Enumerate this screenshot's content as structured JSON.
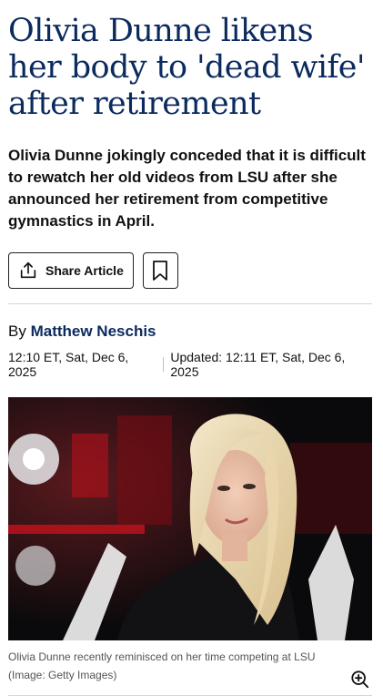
{
  "article": {
    "headline": "Olivia Dunne likens her body to 'dead wife' after retirement",
    "dek": "Olivia Dunne jokingly conceded that it is difficult to rewatch her old videos from LSU after she announced her retirement from competitive gymnastics in April.",
    "share_label": "Share Article",
    "byline_prefix": "By",
    "author": "Matthew Neschis",
    "published": "12:10 ET, Sat, Dec 6, 2025",
    "updated": "Updated: 12:11 ET, Sat, Dec 6, 2025",
    "caption": "Olivia Dunne recently reminisced on her time competing at LSU",
    "credit": "(Image: Getty Images)"
  },
  "colors": {
    "headline": "#0b2a5e",
    "author": "#0b2a5e",
    "photo_bg": "#0a0a0c",
    "photo_accent": "#c4121d"
  },
  "icons": {
    "share": "share-icon",
    "bookmark": "bookmark-icon",
    "zoom": "zoom-in-icon"
  }
}
